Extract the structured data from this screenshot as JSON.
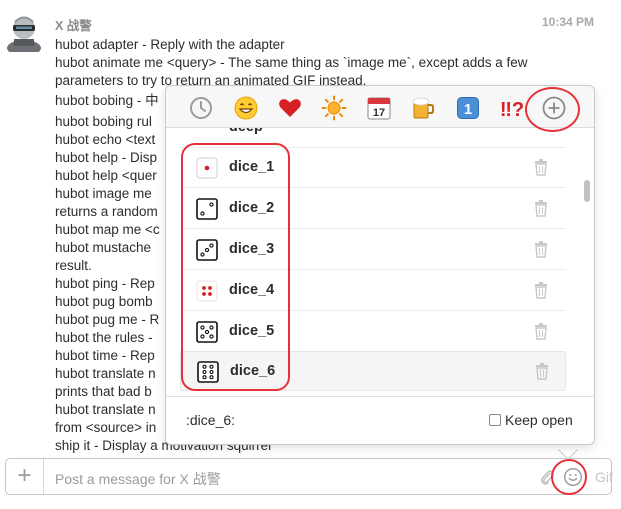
{
  "message": {
    "sender": "X 战警",
    "time": "10:34 PM",
    "lines": [
      "hubot adapter - Reply with the adapter",
      "hubot animate me <query> - The same thing as `image me`, except adds a few",
      "parameters to try to return an animated GIF instead.",
      "hubot bobing - 中",
      "hubot bobing rul",
      "hubot echo <text",
      "hubot help - Disp",
      "hubot help <quer",
      "hubot image me",
      "returns a random",
      "hubot map me <c",
      "hubot mustache",
      "result.",
      "hubot ping - Rep",
      "hubot pug bomb",
      "hubot pug me - R",
      "hubot the rules -",
      "hubot time - Rep",
      "hubot translate n",
      "prints that bad b",
      "hubot translate n",
      "from <source> in",
      "ship it - Display a motivation squirrel"
    ]
  },
  "emoji_picker": {
    "categories": [
      "clock-icon",
      "smile-icon",
      "heart-icon",
      "sun-icon",
      "calendar-icon",
      "beer-icon",
      "number-one-icon",
      "double-exclamation-icon",
      "add-custom-emoji-icon"
    ],
    "partial_row_label": "deep",
    "emojis": [
      {
        "label": "dice_1",
        "pips": 1
      },
      {
        "label": "dice_2",
        "pips": 2
      },
      {
        "label": "dice_3",
        "pips": 3
      },
      {
        "label": "dice_4",
        "pips": 4
      },
      {
        "label": "dice_5",
        "pips": 5
      },
      {
        "label": "dice_6",
        "pips": 6
      }
    ],
    "selected_code": ":dice_6:",
    "keep_open_label": "Keep open",
    "keep_open_checked": false
  },
  "composer": {
    "placeholder": "Post a message for X 战警",
    "gif_label": "Gif"
  },
  "colors": {
    "annotation": "#e8303a",
    "text": "#2c2d30",
    "muted": "#9b9b9b"
  }
}
